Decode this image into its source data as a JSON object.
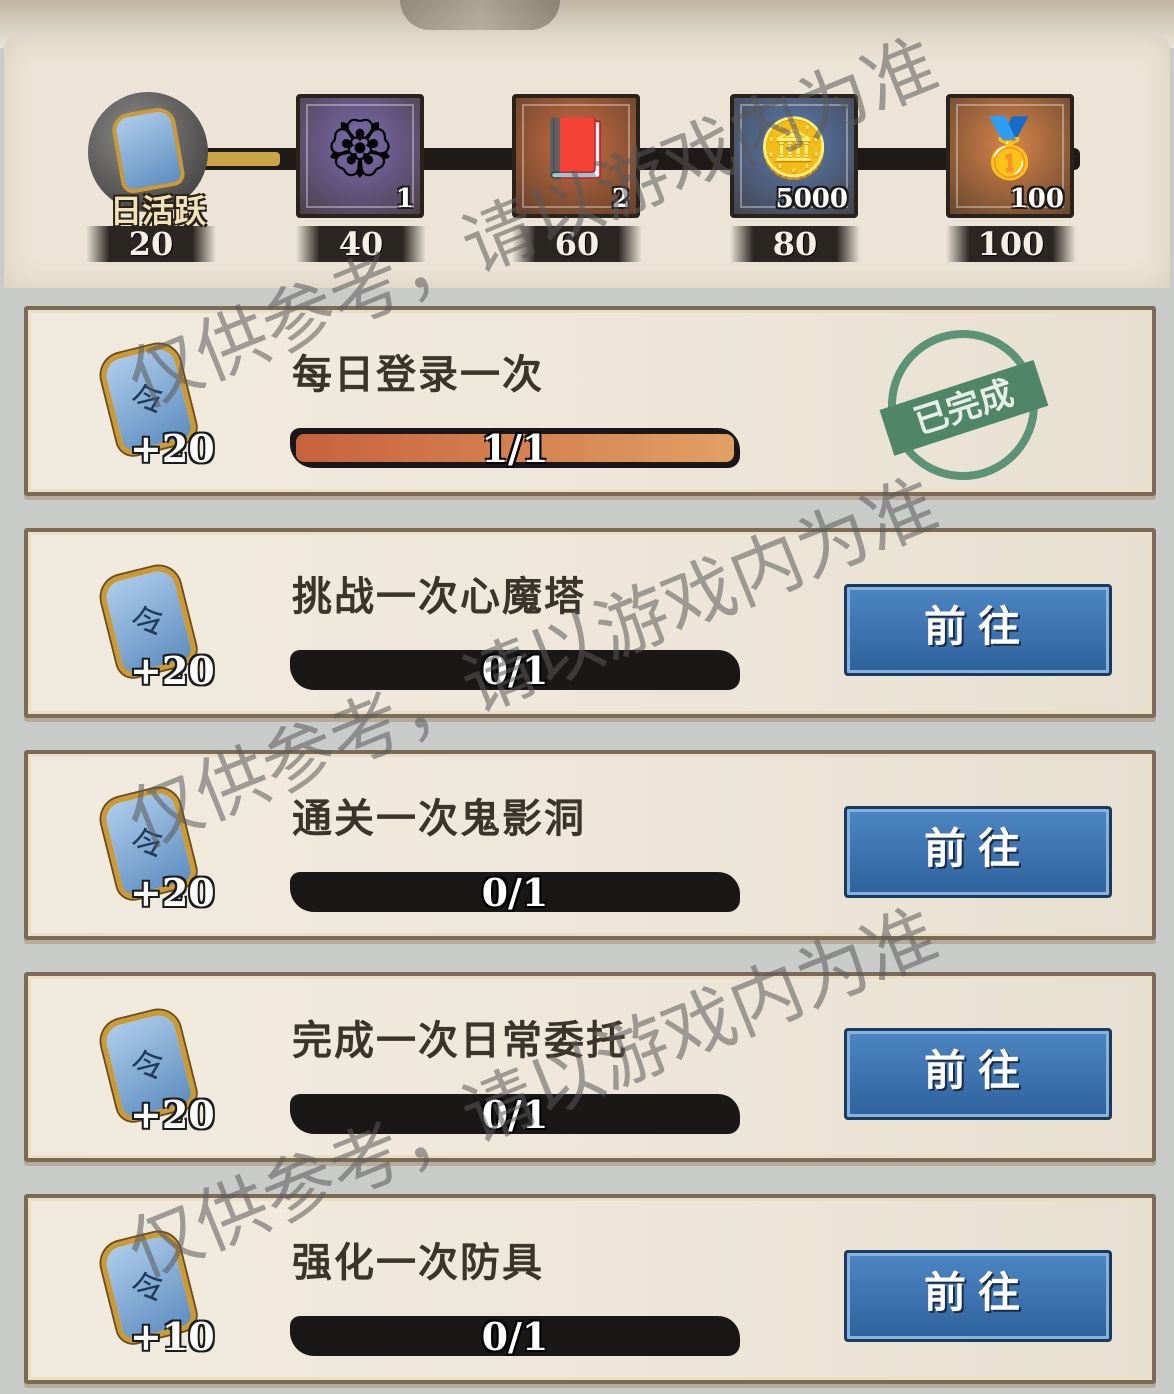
{
  "activity": {
    "label": "日活跃",
    "current": "20",
    "progress_fraction": 0.14
  },
  "milestones": [
    {
      "threshold": "40",
      "qty": "1",
      "item_icon": "token-icon",
      "bg": "#7b6bb0"
    },
    {
      "threshold": "60",
      "qty": "2",
      "item_icon": "book-icon",
      "bg": "#c96e42"
    },
    {
      "threshold": "80",
      "qty": "5000",
      "item_icon": "coin-icon",
      "bg": "#5b7db4"
    },
    {
      "threshold": "100",
      "qty": "100",
      "item_icon": "gold-ingot-icon",
      "bg": "#d7844c"
    }
  ],
  "tasks": [
    {
      "title": "每日登录一次",
      "reward": "+20",
      "progress_text": "1/1",
      "progress": 1,
      "status": "已完成"
    },
    {
      "title": "挑战一次心魔塔",
      "reward": "+20",
      "progress_text": "0/1",
      "progress": 0,
      "button": "前往"
    },
    {
      "title": "通关一次鬼影洞",
      "reward": "+20",
      "progress_text": "0/1",
      "progress": 0,
      "button": "前往"
    },
    {
      "title": "完成一次日常委托",
      "reward": "+20",
      "progress_text": "0/1",
      "progress": 0,
      "button": "前往"
    },
    {
      "title": "强化一次防具",
      "reward": "+10",
      "progress_text": "0/1",
      "progress": 0,
      "button": "前往"
    }
  ],
  "watermark": "仅供参考，请以游戏内为准"
}
